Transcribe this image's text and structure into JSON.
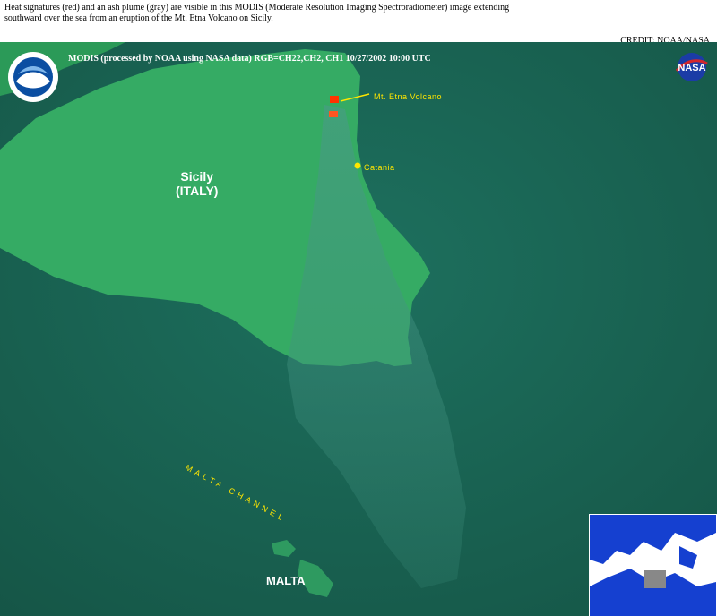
{
  "caption": {
    "text": "Heat signatures (red) and an ash plume (gray) are visible in this MODIS (Moderate Resolution Imaging Spectroradiometer) image extending southward over the sea from an eruption of the Mt. Etna Volcano on Sicily.",
    "credit": "CREDIT: NOAA/NASA"
  },
  "image_header": "MODIS  (processed by NOAA using NASA data)  RGB=CH22,CH2, CH1  10/27/2002  10:00 UTC",
  "labels": {
    "sicily_line1": "Sicily",
    "sicily_line2": "(ITALY)",
    "malta": "MALTA",
    "etna": "Mt. Etna Volcano",
    "catania": "Catania",
    "channel": "MALTA CHANNEL"
  },
  "logos": {
    "left": "noaa-logo-icon",
    "right": "nasa-logo-icon"
  },
  "colors": {
    "sea": "#1b6b5a",
    "land": "#2fa860",
    "plume": "#3f8f80",
    "heat": "#ff3300",
    "label_yellow": "#ffe600"
  }
}
